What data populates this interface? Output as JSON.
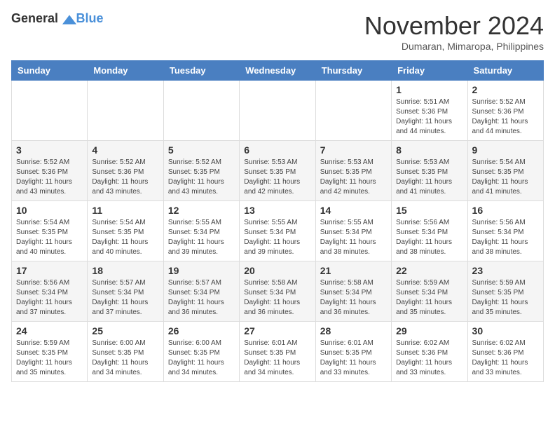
{
  "header": {
    "logo_general": "General",
    "logo_blue": "Blue",
    "month_title": "November 2024",
    "location": "Dumaran, Mimaropa, Philippines"
  },
  "weekdays": [
    "Sunday",
    "Monday",
    "Tuesday",
    "Wednesday",
    "Thursday",
    "Friday",
    "Saturday"
  ],
  "weeks": [
    [
      {
        "day": "",
        "info": ""
      },
      {
        "day": "",
        "info": ""
      },
      {
        "day": "",
        "info": ""
      },
      {
        "day": "",
        "info": ""
      },
      {
        "day": "",
        "info": ""
      },
      {
        "day": "1",
        "info": "Sunrise: 5:51 AM\nSunset: 5:36 PM\nDaylight: 11 hours\nand 44 minutes."
      },
      {
        "day": "2",
        "info": "Sunrise: 5:52 AM\nSunset: 5:36 PM\nDaylight: 11 hours\nand 44 minutes."
      }
    ],
    [
      {
        "day": "3",
        "info": "Sunrise: 5:52 AM\nSunset: 5:36 PM\nDaylight: 11 hours\nand 43 minutes."
      },
      {
        "day": "4",
        "info": "Sunrise: 5:52 AM\nSunset: 5:36 PM\nDaylight: 11 hours\nand 43 minutes."
      },
      {
        "day": "5",
        "info": "Sunrise: 5:52 AM\nSunset: 5:35 PM\nDaylight: 11 hours\nand 43 minutes."
      },
      {
        "day": "6",
        "info": "Sunrise: 5:53 AM\nSunset: 5:35 PM\nDaylight: 11 hours\nand 42 minutes."
      },
      {
        "day": "7",
        "info": "Sunrise: 5:53 AM\nSunset: 5:35 PM\nDaylight: 11 hours\nand 42 minutes."
      },
      {
        "day": "8",
        "info": "Sunrise: 5:53 AM\nSunset: 5:35 PM\nDaylight: 11 hours\nand 41 minutes."
      },
      {
        "day": "9",
        "info": "Sunrise: 5:54 AM\nSunset: 5:35 PM\nDaylight: 11 hours\nand 41 minutes."
      }
    ],
    [
      {
        "day": "10",
        "info": "Sunrise: 5:54 AM\nSunset: 5:35 PM\nDaylight: 11 hours\nand 40 minutes."
      },
      {
        "day": "11",
        "info": "Sunrise: 5:54 AM\nSunset: 5:35 PM\nDaylight: 11 hours\nand 40 minutes."
      },
      {
        "day": "12",
        "info": "Sunrise: 5:55 AM\nSunset: 5:34 PM\nDaylight: 11 hours\nand 39 minutes."
      },
      {
        "day": "13",
        "info": "Sunrise: 5:55 AM\nSunset: 5:34 PM\nDaylight: 11 hours\nand 39 minutes."
      },
      {
        "day": "14",
        "info": "Sunrise: 5:55 AM\nSunset: 5:34 PM\nDaylight: 11 hours\nand 38 minutes."
      },
      {
        "day": "15",
        "info": "Sunrise: 5:56 AM\nSunset: 5:34 PM\nDaylight: 11 hours\nand 38 minutes."
      },
      {
        "day": "16",
        "info": "Sunrise: 5:56 AM\nSunset: 5:34 PM\nDaylight: 11 hours\nand 38 minutes."
      }
    ],
    [
      {
        "day": "17",
        "info": "Sunrise: 5:56 AM\nSunset: 5:34 PM\nDaylight: 11 hours\nand 37 minutes."
      },
      {
        "day": "18",
        "info": "Sunrise: 5:57 AM\nSunset: 5:34 PM\nDaylight: 11 hours\nand 37 minutes."
      },
      {
        "day": "19",
        "info": "Sunrise: 5:57 AM\nSunset: 5:34 PM\nDaylight: 11 hours\nand 36 minutes."
      },
      {
        "day": "20",
        "info": "Sunrise: 5:58 AM\nSunset: 5:34 PM\nDaylight: 11 hours\nand 36 minutes."
      },
      {
        "day": "21",
        "info": "Sunrise: 5:58 AM\nSunset: 5:34 PM\nDaylight: 11 hours\nand 36 minutes."
      },
      {
        "day": "22",
        "info": "Sunrise: 5:59 AM\nSunset: 5:34 PM\nDaylight: 11 hours\nand 35 minutes."
      },
      {
        "day": "23",
        "info": "Sunrise: 5:59 AM\nSunset: 5:35 PM\nDaylight: 11 hours\nand 35 minutes."
      }
    ],
    [
      {
        "day": "24",
        "info": "Sunrise: 5:59 AM\nSunset: 5:35 PM\nDaylight: 11 hours\nand 35 minutes."
      },
      {
        "day": "25",
        "info": "Sunrise: 6:00 AM\nSunset: 5:35 PM\nDaylight: 11 hours\nand 34 minutes."
      },
      {
        "day": "26",
        "info": "Sunrise: 6:00 AM\nSunset: 5:35 PM\nDaylight: 11 hours\nand 34 minutes."
      },
      {
        "day": "27",
        "info": "Sunrise: 6:01 AM\nSunset: 5:35 PM\nDaylight: 11 hours\nand 34 minutes."
      },
      {
        "day": "28",
        "info": "Sunrise: 6:01 AM\nSunset: 5:35 PM\nDaylight: 11 hours\nand 33 minutes."
      },
      {
        "day": "29",
        "info": "Sunrise: 6:02 AM\nSunset: 5:36 PM\nDaylight: 11 hours\nand 33 minutes."
      },
      {
        "day": "30",
        "info": "Sunrise: 6:02 AM\nSunset: 5:36 PM\nDaylight: 11 hours\nand 33 minutes."
      }
    ]
  ]
}
